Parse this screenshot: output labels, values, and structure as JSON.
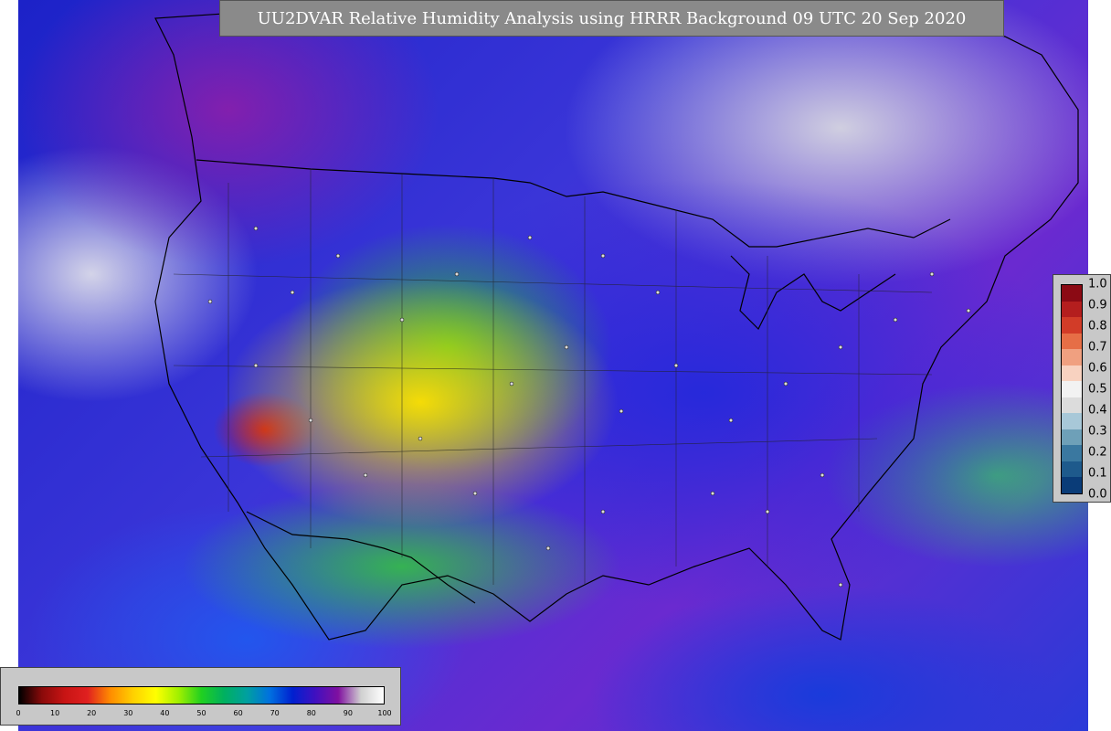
{
  "title": "UU2DVAR Relative Humidity Analysis using HRRR Background 09 UTC 20 Sep 2020",
  "legend": {
    "ticks": [
      "0",
      "10",
      "20",
      "30",
      "40",
      "50",
      "60",
      "70",
      "80",
      "90",
      "100"
    ],
    "gradient_stops": [
      "#000000",
      "#8a0a0a",
      "#c81414",
      "#e02020",
      "#ff8c00",
      "#ffd000",
      "#ffff00",
      "#a0f000",
      "#20d020",
      "#00b060",
      "#00a0a0",
      "#0070e0",
      "#0020d0",
      "#4010c0",
      "#8010a0",
      "#d0d0d0",
      "#ffffff"
    ]
  },
  "fraction_scale": {
    "ticks": [
      "1.0",
      "0.9",
      "0.8",
      "0.7",
      "0.6",
      "0.5",
      "0.4",
      "0.3",
      "0.2",
      "0.1",
      "0.0"
    ],
    "colors_top_to_bottom": [
      "#8b0a14",
      "#b41e1e",
      "#d23c28",
      "#e66e46",
      "#f0a080",
      "#f8d2c0",
      "#f2f2f2",
      "#dcdcdc",
      "#a8c8d8",
      "#6ea0b8",
      "#3a78a0",
      "#1e5a8c",
      "#0a3c78"
    ]
  }
}
